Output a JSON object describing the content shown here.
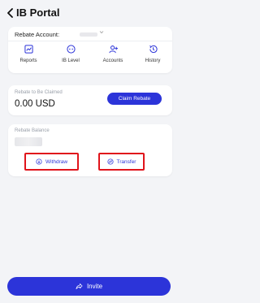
{
  "header": {
    "title": "IB Portal",
    "back_icon": "chevron-left-icon"
  },
  "account": {
    "label": "Rebate Account:",
    "nav": [
      {
        "label": "Reports",
        "icon": "reports-icon"
      },
      {
        "label": "IB Level",
        "icon": "ib-level-icon"
      },
      {
        "label": "Accounts",
        "icon": "accounts-icon"
      },
      {
        "label": "History",
        "icon": "history-icon"
      }
    ]
  },
  "claim": {
    "label": "Rebate to Be Claimed",
    "amount": "0.00 USD",
    "button_label": "Claim Rebate"
  },
  "balance": {
    "label": "Rebate Balance",
    "withdraw_label": "Withdraw",
    "transfer_label": "Transfer"
  },
  "footer": {
    "invite_label": "Invite"
  },
  "colors": {
    "accent": "#2c34d9",
    "highlight": "#e0141b",
    "background": "#f3f4f7"
  }
}
